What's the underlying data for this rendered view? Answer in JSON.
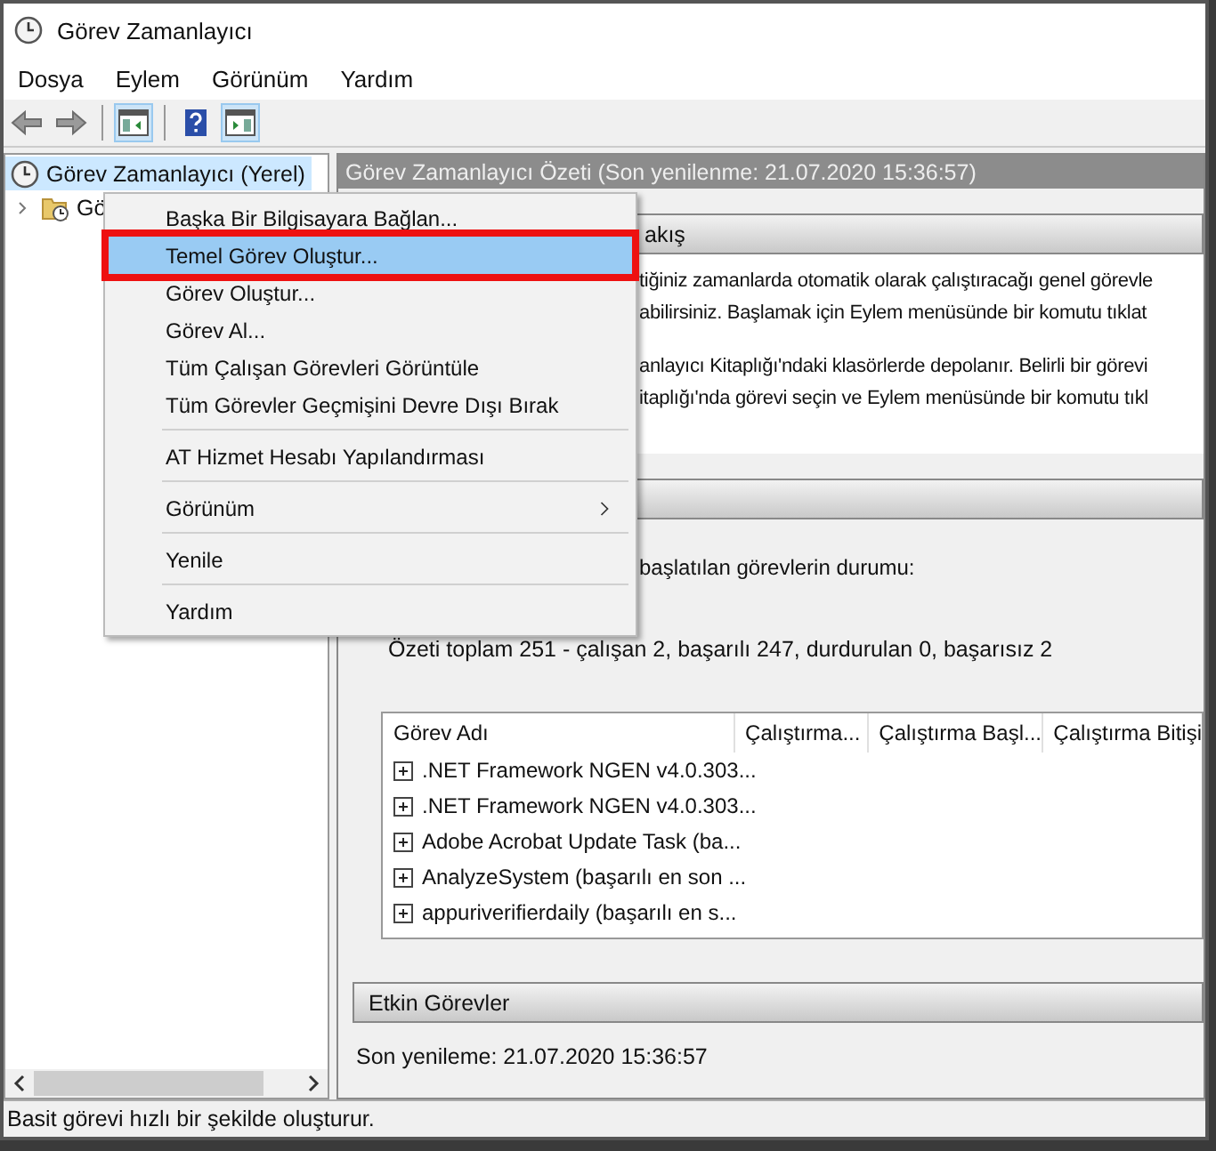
{
  "window": {
    "title": "Görev Zamanlayıcı"
  },
  "menu_bar": [
    "Dosya",
    "Eylem",
    "Görünüm",
    "Yardım"
  ],
  "toolbar": [
    {
      "kind": "back",
      "pressed": false
    },
    {
      "kind": "forward",
      "pressed": false
    },
    {
      "kind": "tree-pane",
      "pressed": true
    },
    {
      "kind": "help",
      "pressed": false
    },
    {
      "kind": "action-pane",
      "pressed": true
    }
  ],
  "tree": [
    {
      "label": "Görev Zamanlayıcı (Yerel)",
      "selected": true,
      "children": [
        {
          "label": "Gö",
          "selected": false,
          "expanded": false
        }
      ]
    }
  ],
  "context_menu": [
    {
      "label": "Başka Bir Bilgisayara Bağlan...",
      "selected": false,
      "submenu": false,
      "separator_after": false
    },
    {
      "label": "Temel Görev Oluştur...",
      "selected": true,
      "submenu": false,
      "separator_after": false
    },
    {
      "label": "Görev Oluştur...",
      "selected": false,
      "submenu": false,
      "separator_after": false
    },
    {
      "label": "Görev Al...",
      "selected": false,
      "submenu": false,
      "separator_after": false
    },
    {
      "label": "Tüm Çalışan Görevleri Görüntüle",
      "selected": false,
      "submenu": false,
      "separator_after": false
    },
    {
      "label": "Tüm Görevler Geçmişini Devre Dışı Bırak",
      "selected": false,
      "submenu": false,
      "separator_after": true
    },
    {
      "label": "AT Hizmet Hesabı Yapılandırması",
      "selected": false,
      "submenu": false,
      "separator_after": true
    },
    {
      "label": "Görünüm",
      "selected": false,
      "submenu": true,
      "separator_after": true
    },
    {
      "label": "Yenile",
      "selected": false,
      "submenu": false,
      "separator_after": true
    },
    {
      "label": "Yardım",
      "selected": false,
      "submenu": false,
      "separator_after": false
    }
  ],
  "summary_header": "Görev Zamanlayıcı Özeti (Son yenilenme: 21.07.2020 15:36:57)",
  "overview": {
    "header": "akış",
    "paragraphs": [
      [
        "tiğiniz zamanlarda otomatik olarak çalıştıracağı genel görevle",
        "abilirsiniz. Başlamak için Eylem menüsünde bir komutu tıklat"
      ],
      [
        "anlayıcı Kitaplığı'ndaki klasörlerde depolanır. Belirli bir görevi",
        "itaplığı'nda görevi seçin ve Eylem menüsünde bir komutu tıkl"
      ]
    ]
  },
  "status": {
    "intro": "başlatılan görevlerin durumu:",
    "totals": "Özeti toplam 251 - çalışan 2, başarılı 247, durdurulan 0, başarısız 2",
    "table": {
      "columns": [
        "Görev Adı",
        "Çalıştırma...",
        "Çalıştırma Başl...",
        "Çalıştırma Bitişi"
      ],
      "rows": [
        ".NET Framework NGEN v4.0.303...",
        ".NET Framework NGEN v4.0.303...",
        "Adobe Acrobat Update Task (ba...",
        "AnalyzeSystem (başarılı en son ...",
        "appuriverifierdaily (başarılı en s..."
      ]
    }
  },
  "active_tasks": {
    "header": "Etkin Görevler",
    "refreshed": "Son yenileme: 21.07.2020 15:36:57"
  },
  "status_bar": "Basit görevi hızlı bir şekilde oluşturur."
}
